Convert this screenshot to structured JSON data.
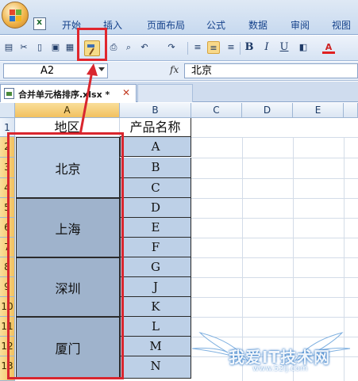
{
  "ribbon": {
    "tabs": [
      "开始",
      "插入",
      "页面布局",
      "公式",
      "数据",
      "审阅",
      "视图"
    ]
  },
  "toolbar": {
    "icons": [
      "clipboard-icon",
      "cut-icon",
      "new-file-icon",
      "save-icon",
      "print-preview-icon",
      "format-painter-icon",
      "print-icon",
      "find-icon",
      "undo-icon",
      "redo-icon",
      "align-left-icon",
      "align-center-icon",
      "align-right-icon",
      "bold-icon",
      "italic-icon",
      "underline-icon",
      "fill-color-icon",
      "font-color-icon"
    ],
    "bold": "B",
    "italic": "I",
    "underline": "U",
    "font_color_letter": "A"
  },
  "formula_bar": {
    "name_box": "A2",
    "fx_label": "fx",
    "value": "北京"
  },
  "document": {
    "tab_name": "合并单元格排序.xlsx *",
    "close": "✕"
  },
  "sheet": {
    "columns": [
      "A",
      "B",
      "C",
      "D",
      "E"
    ],
    "selected_column": "A",
    "rows": [
      "1",
      "2",
      "3",
      "4",
      "5",
      "6",
      "7",
      "8",
      "9",
      "10",
      "11",
      "12",
      "13"
    ],
    "headers": {
      "A1": "地区",
      "B1": "产品名称"
    },
    "regions": [
      {
        "label": "北京",
        "span": 3
      },
      {
        "label": "上海",
        "span": 3
      },
      {
        "label": "深圳",
        "span": 3
      },
      {
        "label": "厦门",
        "span": 3
      }
    ],
    "products": [
      "A",
      "B",
      "C",
      "D",
      "E",
      "F",
      "G",
      "J",
      "K",
      "L",
      "M",
      "N"
    ]
  },
  "colors": {
    "accent_red": "#d9262e",
    "selection": "#bdd0e7",
    "ribbon": "#c7d9ef"
  },
  "watermark": {
    "text": "我爱IT技术网",
    "url": "www.52ij.com"
  }
}
